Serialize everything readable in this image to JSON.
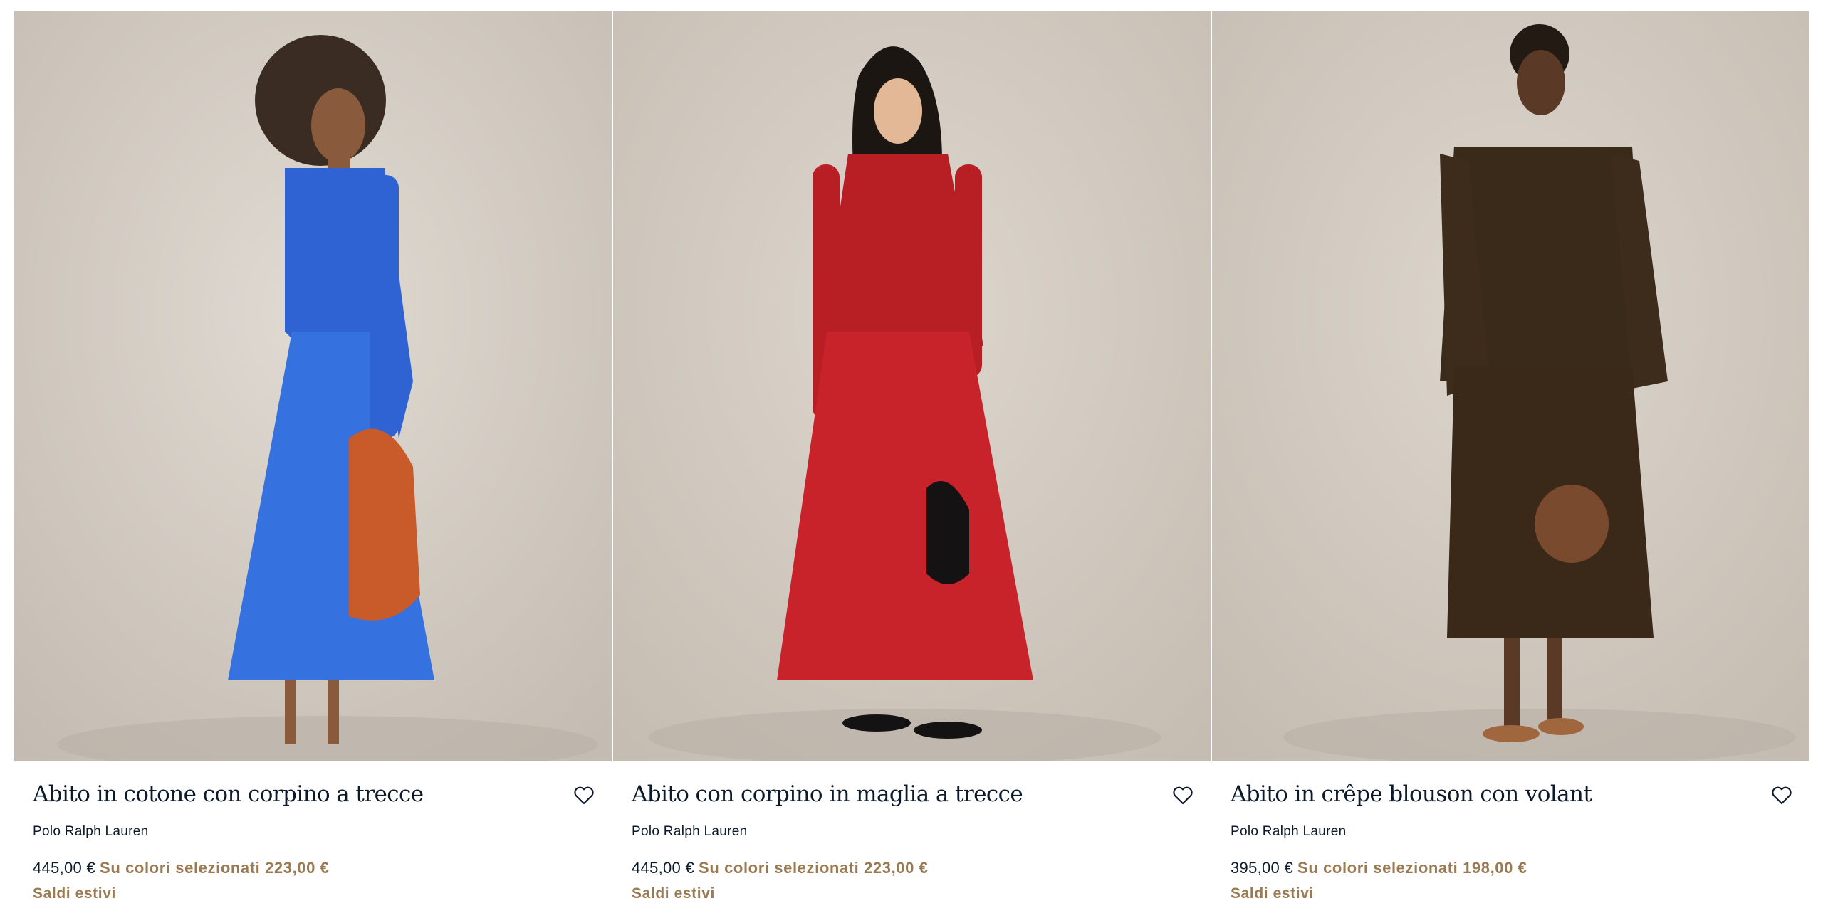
{
  "colors": {
    "backdrop": "#d4cdc4",
    "text": "#0c1a2b",
    "sale": "#9a7a52"
  },
  "products": [
    {
      "title": "Abito in cotone con corpino a trecce",
      "brand": "Polo Ralph Lauren",
      "price": "445,00 €",
      "sale_text": "Su colori selezionati 223,00 €",
      "tag": "Saldi estivi",
      "wishlist_icon": "heart-outline-icon",
      "image_subject": "model in blue cable-knit bodice dress with orange bag"
    },
    {
      "title": "Abito con corpino in maglia a trecce",
      "brand": "Polo Ralph Lauren",
      "price": "445,00 €",
      "sale_text": "Su colori selezionati 223,00 €",
      "tag": "Saldi estivi",
      "wishlist_icon": "heart-outline-icon",
      "image_subject": "model in red cable-knit bodice dress with black bag"
    },
    {
      "title": "Abito in crêpe blouson con volant",
      "brand": "Polo Ralph Lauren",
      "price": "395,00 €",
      "sale_text": "Su colori selezionati 198,00 €",
      "tag": "Saldi estivi",
      "wishlist_icon": "heart-outline-icon",
      "image_subject": "model in brown ruffled crepe dress with tan bag"
    }
  ]
}
